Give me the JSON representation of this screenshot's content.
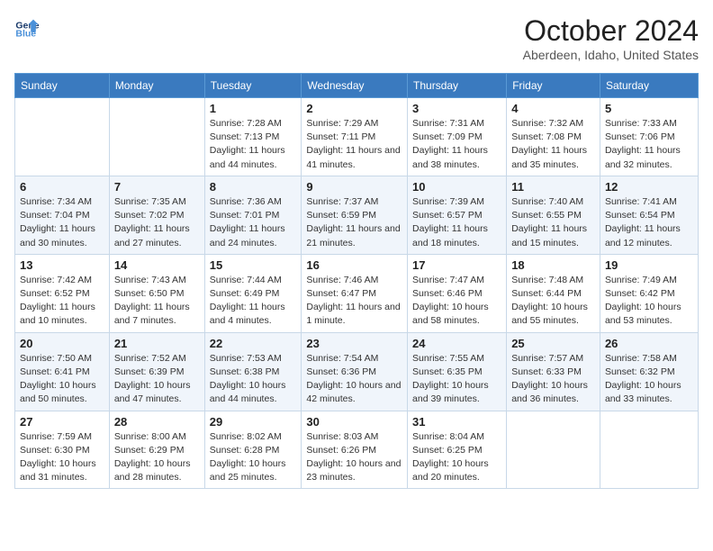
{
  "header": {
    "logo_line1": "General",
    "logo_line2": "Blue",
    "title": "October 2024",
    "subtitle": "Aberdeen, Idaho, United States"
  },
  "days_of_week": [
    "Sunday",
    "Monday",
    "Tuesday",
    "Wednesday",
    "Thursday",
    "Friday",
    "Saturday"
  ],
  "weeks": [
    [
      {
        "day": "",
        "info": ""
      },
      {
        "day": "",
        "info": ""
      },
      {
        "day": "1",
        "info": "Sunrise: 7:28 AM\nSunset: 7:13 PM\nDaylight: 11 hours and 44 minutes."
      },
      {
        "day": "2",
        "info": "Sunrise: 7:29 AM\nSunset: 7:11 PM\nDaylight: 11 hours and 41 minutes."
      },
      {
        "day": "3",
        "info": "Sunrise: 7:31 AM\nSunset: 7:09 PM\nDaylight: 11 hours and 38 minutes."
      },
      {
        "day": "4",
        "info": "Sunrise: 7:32 AM\nSunset: 7:08 PM\nDaylight: 11 hours and 35 minutes."
      },
      {
        "day": "5",
        "info": "Sunrise: 7:33 AM\nSunset: 7:06 PM\nDaylight: 11 hours and 32 minutes."
      }
    ],
    [
      {
        "day": "6",
        "info": "Sunrise: 7:34 AM\nSunset: 7:04 PM\nDaylight: 11 hours and 30 minutes."
      },
      {
        "day": "7",
        "info": "Sunrise: 7:35 AM\nSunset: 7:02 PM\nDaylight: 11 hours and 27 minutes."
      },
      {
        "day": "8",
        "info": "Sunrise: 7:36 AM\nSunset: 7:01 PM\nDaylight: 11 hours and 24 minutes."
      },
      {
        "day": "9",
        "info": "Sunrise: 7:37 AM\nSunset: 6:59 PM\nDaylight: 11 hours and 21 minutes."
      },
      {
        "day": "10",
        "info": "Sunrise: 7:39 AM\nSunset: 6:57 PM\nDaylight: 11 hours and 18 minutes."
      },
      {
        "day": "11",
        "info": "Sunrise: 7:40 AM\nSunset: 6:55 PM\nDaylight: 11 hours and 15 minutes."
      },
      {
        "day": "12",
        "info": "Sunrise: 7:41 AM\nSunset: 6:54 PM\nDaylight: 11 hours and 12 minutes."
      }
    ],
    [
      {
        "day": "13",
        "info": "Sunrise: 7:42 AM\nSunset: 6:52 PM\nDaylight: 11 hours and 10 minutes."
      },
      {
        "day": "14",
        "info": "Sunrise: 7:43 AM\nSunset: 6:50 PM\nDaylight: 11 hours and 7 minutes."
      },
      {
        "day": "15",
        "info": "Sunrise: 7:44 AM\nSunset: 6:49 PM\nDaylight: 11 hours and 4 minutes."
      },
      {
        "day": "16",
        "info": "Sunrise: 7:46 AM\nSunset: 6:47 PM\nDaylight: 11 hours and 1 minute."
      },
      {
        "day": "17",
        "info": "Sunrise: 7:47 AM\nSunset: 6:46 PM\nDaylight: 10 hours and 58 minutes."
      },
      {
        "day": "18",
        "info": "Sunrise: 7:48 AM\nSunset: 6:44 PM\nDaylight: 10 hours and 55 minutes."
      },
      {
        "day": "19",
        "info": "Sunrise: 7:49 AM\nSunset: 6:42 PM\nDaylight: 10 hours and 53 minutes."
      }
    ],
    [
      {
        "day": "20",
        "info": "Sunrise: 7:50 AM\nSunset: 6:41 PM\nDaylight: 10 hours and 50 minutes."
      },
      {
        "day": "21",
        "info": "Sunrise: 7:52 AM\nSunset: 6:39 PM\nDaylight: 10 hours and 47 minutes."
      },
      {
        "day": "22",
        "info": "Sunrise: 7:53 AM\nSunset: 6:38 PM\nDaylight: 10 hours and 44 minutes."
      },
      {
        "day": "23",
        "info": "Sunrise: 7:54 AM\nSunset: 6:36 PM\nDaylight: 10 hours and 42 minutes."
      },
      {
        "day": "24",
        "info": "Sunrise: 7:55 AM\nSunset: 6:35 PM\nDaylight: 10 hours and 39 minutes."
      },
      {
        "day": "25",
        "info": "Sunrise: 7:57 AM\nSunset: 6:33 PM\nDaylight: 10 hours and 36 minutes."
      },
      {
        "day": "26",
        "info": "Sunrise: 7:58 AM\nSunset: 6:32 PM\nDaylight: 10 hours and 33 minutes."
      }
    ],
    [
      {
        "day": "27",
        "info": "Sunrise: 7:59 AM\nSunset: 6:30 PM\nDaylight: 10 hours and 31 minutes."
      },
      {
        "day": "28",
        "info": "Sunrise: 8:00 AM\nSunset: 6:29 PM\nDaylight: 10 hours and 28 minutes."
      },
      {
        "day": "29",
        "info": "Sunrise: 8:02 AM\nSunset: 6:28 PM\nDaylight: 10 hours and 25 minutes."
      },
      {
        "day": "30",
        "info": "Sunrise: 8:03 AM\nSunset: 6:26 PM\nDaylight: 10 hours and 23 minutes."
      },
      {
        "day": "31",
        "info": "Sunrise: 8:04 AM\nSunset: 6:25 PM\nDaylight: 10 hours and 20 minutes."
      },
      {
        "day": "",
        "info": ""
      },
      {
        "day": "",
        "info": ""
      }
    ]
  ]
}
